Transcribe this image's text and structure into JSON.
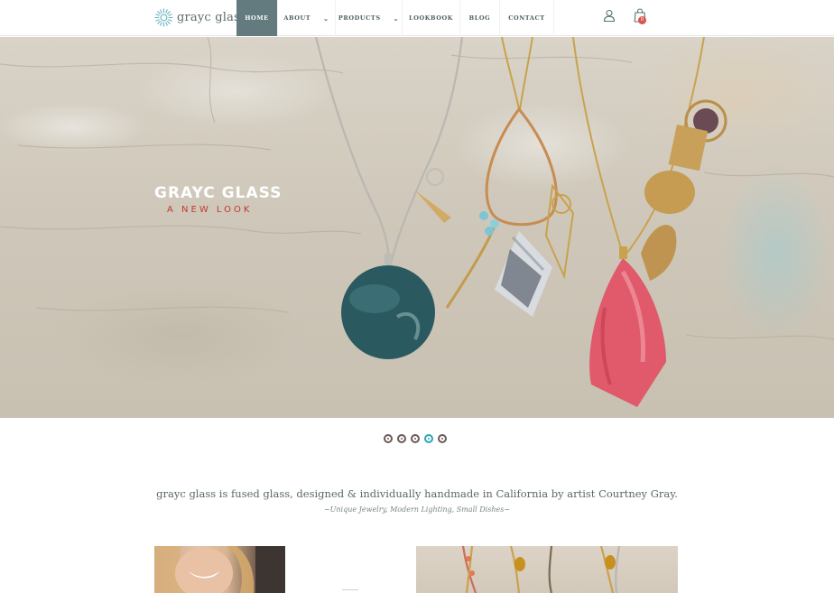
{
  "brand": {
    "name": "grayc glass",
    "logo_icon": "sunburst-logo-icon",
    "accent": "#637b7e"
  },
  "nav": {
    "items": [
      {
        "label": "HOME",
        "active": true,
        "has_dropdown": false
      },
      {
        "label": "ABOUT",
        "active": false,
        "has_dropdown": true
      },
      {
        "label": "PRODUCTS",
        "active": false,
        "has_dropdown": true
      },
      {
        "label": "LOOKBOOK",
        "active": false,
        "has_dropdown": false
      },
      {
        "label": "BLOG",
        "active": false,
        "has_dropdown": false
      },
      {
        "label": "CONTACT",
        "active": false,
        "has_dropdown": false
      }
    ]
  },
  "header_actions": {
    "account_icon": "user-icon",
    "cart_icon": "shopping-bag-icon",
    "cart_count": "0",
    "badge_color": "#d9534f"
  },
  "hero": {
    "title": "GRAYC GLASS",
    "subtitle": "A NEW LOOK",
    "subtitle_color": "#c0392b"
  },
  "slider": {
    "total": 5,
    "active_index": 3,
    "active_color": "#2aa6b4"
  },
  "intro": {
    "text": "grayc glass is fused glass, designed & individually handmade in California by artist Courtney Gray.",
    "tagline": "~Unique Jewelry, Modern Lighting, Small Dishes~"
  }
}
